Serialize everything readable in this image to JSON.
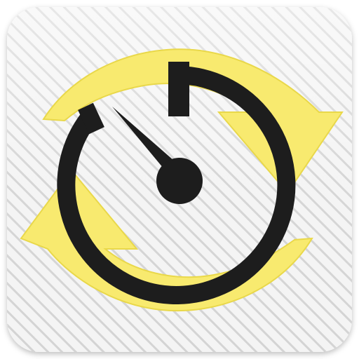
{
  "app_icon": {
    "icon": "timer-sync-icon",
    "colors": {
      "background": "#f4f4f4",
      "stripes": "#d4d4d4",
      "arrows": "#f8ea6f",
      "arrow_edge": "#e9d84a",
      "clock": "#1d1d1d"
    }
  }
}
